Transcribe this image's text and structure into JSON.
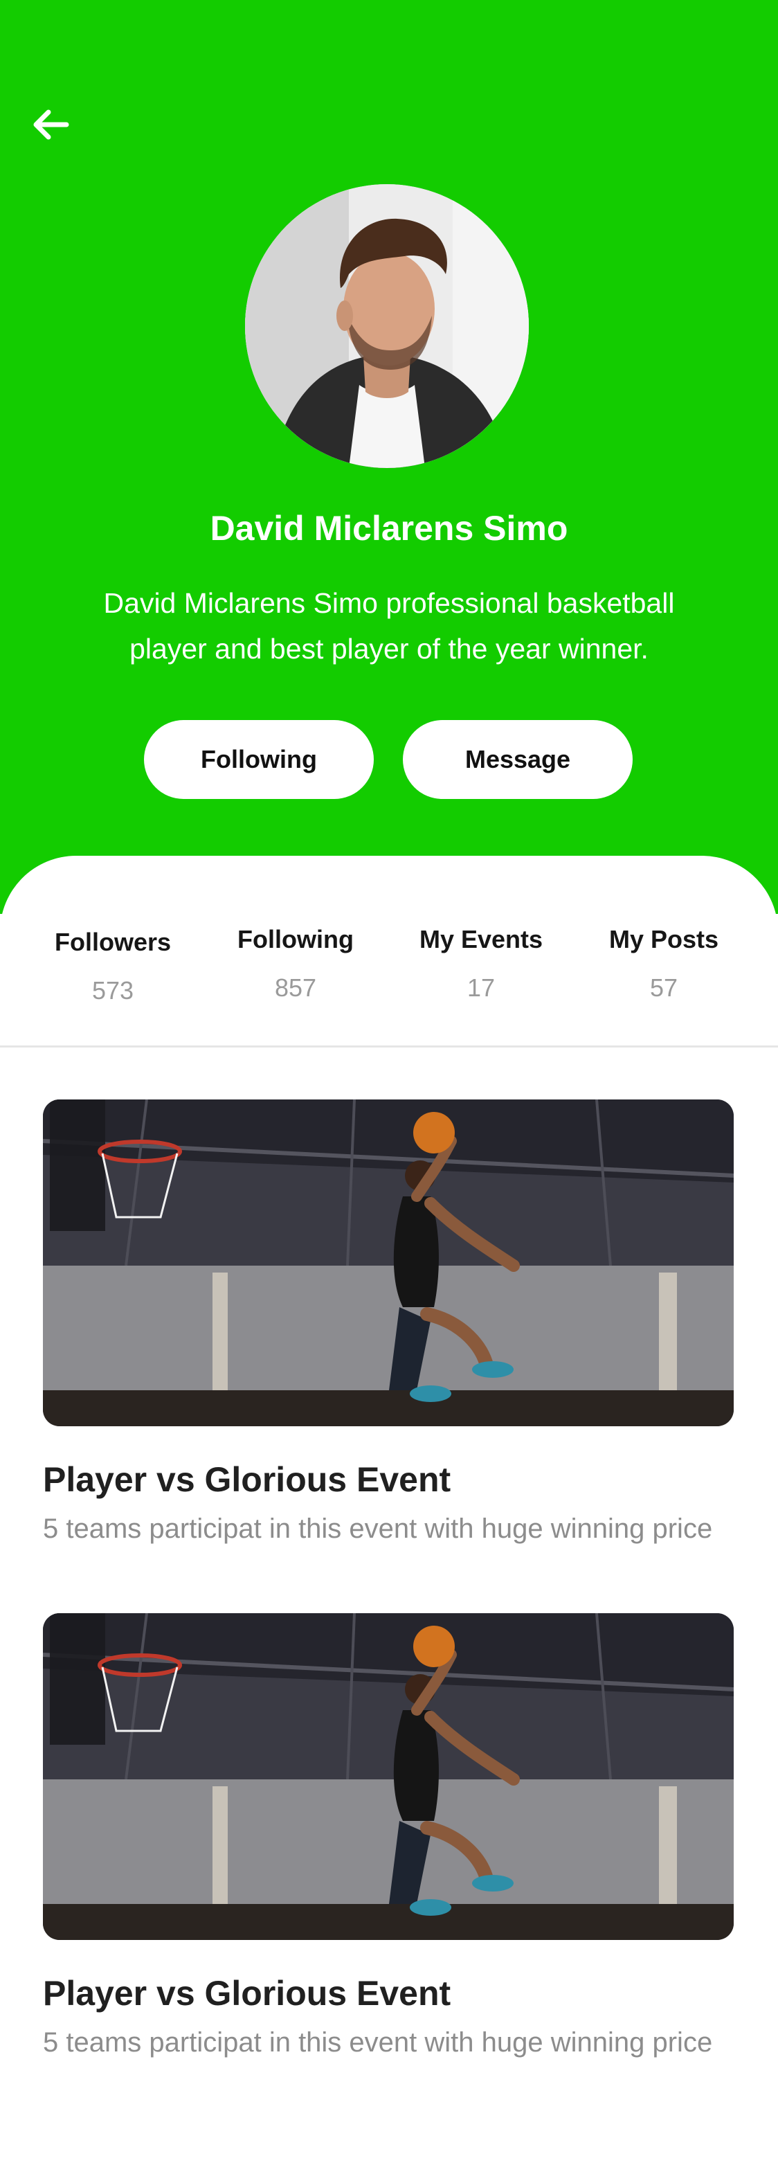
{
  "profile": {
    "name": "David Miclarens Simo",
    "bio": "David Miclarens Simo professional basketball player and best player of the year winner.",
    "following_button": "Following",
    "message_button": "Message"
  },
  "stats": [
    {
      "label": "Followers",
      "value": "573"
    },
    {
      "label": "Following",
      "value": "857"
    },
    {
      "label": "My Events",
      "value": "17"
    },
    {
      "label": "My Posts",
      "value": "57"
    }
  ],
  "events": [
    {
      "title": "Player vs Glorious Event",
      "description": "5 teams participat in this event with huge winning price"
    },
    {
      "title": "Player vs Glorious Event",
      "description": "5 teams participat in this event with huge winning price"
    }
  ],
  "colors": {
    "header_green": "#13cc00",
    "text_dark": "#202020",
    "text_muted": "#8c8c8c"
  },
  "icons": {
    "back": "arrow-left-icon"
  }
}
